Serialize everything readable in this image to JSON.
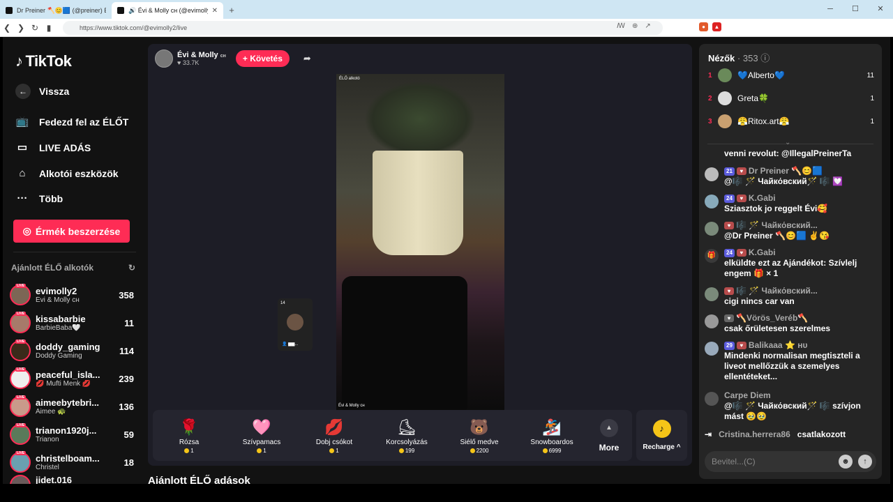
{
  "browser": {
    "tabs": [
      {
        "title": "Dr Preiner 🪓😊🟦 (@preiner) ÉLŐ",
        "active": false
      },
      {
        "title": "🔊 Évi & Molly ᴄʜ (@evimolly2) ÉLŐ",
        "active": true
      }
    ],
    "url": "https://www.tiktok.com/@evimolly2/live",
    "new_tab": "+",
    "min": "─",
    "max": "☐",
    "close": "✕"
  },
  "sidebar": {
    "logo": "TikTok",
    "back": "Vissza",
    "nav": [
      {
        "label": "Fedezd fel az ÉLŐT",
        "icon": "tv-icon"
      },
      {
        "label": "LIVE ADÁS",
        "icon": "video-icon"
      },
      {
        "label": "Alkotói eszközök",
        "icon": "home-play-icon"
      },
      {
        "label": "Több",
        "icon": "more-icon"
      }
    ],
    "coin_button": "Érmék beszerzése",
    "suggest_title": "Ajánlott ÉLŐ alkotók",
    "creators": [
      {
        "name": "evimolly2",
        "sub": "Évi & Molly ᴄʜ",
        "count": "358"
      },
      {
        "name": "kissabarbie",
        "sub": "BarbieBaba🤍",
        "count": "11"
      },
      {
        "name": "doddy_gaming",
        "sub": "Doddy Gaming",
        "count": "114"
      },
      {
        "name": "peaceful_isla...",
        "sub": "💋 Mufti Menk 💋",
        "count": "239"
      },
      {
        "name": "aimeebytebri...",
        "sub": "Aimee 🐢",
        "count": "136"
      },
      {
        "name": "trianon1920j...",
        "sub": "Trianon",
        "count": "59"
      },
      {
        "name": "christelboam...",
        "sub": "Christel",
        "count": "18"
      },
      {
        "name": "jidet.016",
        "sub": "",
        "count": ""
      }
    ]
  },
  "host": {
    "name": "Évi & Molly",
    "badge": "ᴄʜ",
    "likes": "♥ 33.7K",
    "follow": "+ Követés"
  },
  "video": {
    "top_label": "ÉLŐ alkotó",
    "bottom_label": "Évi & Molly ᴄʜ",
    "guest_count": "14",
    "guest_label": "👤 ▆▆..."
  },
  "gifts": [
    {
      "name": "Rózsa",
      "price": "1",
      "icon": "🌹"
    },
    {
      "name": "Szívpamacs",
      "price": "1",
      "icon": "🩷"
    },
    {
      "name": "Dobj csókot",
      "price": "1",
      "icon": "💋"
    },
    {
      "name": "Korcsolyázás",
      "price": "199",
      "icon": "⛸"
    },
    {
      "name": "Siélő medve",
      "price": "2200",
      "icon": "🐻"
    },
    {
      "name": "Snowboardos",
      "price": "6999",
      "icon": "🏂"
    }
  ],
  "more_label": "More",
  "recharge_label": "Recharge ^",
  "below_title": "Ajánlott ÉLŐ adások",
  "chat": {
    "viewers_title": "Nézők",
    "viewers_count": "· 353",
    "top_viewers": [
      {
        "rank": "1",
        "name": "💙Alberto💙",
        "score": "11"
      },
      {
        "rank": "2",
        "name": "Greta🍀",
        "score": "1"
      },
      {
        "rank": "3",
        "name": "😤Ritox.art😤",
        "score": "1"
      }
    ],
    "messages": [
      {
        "user": "",
        "level": "",
        "text": "venni revolut: @IllegalPreinerTa"
      },
      {
        "user": "Dr Preiner 🪓😊🟦",
        "level": "21",
        "text": "@🎼 🪄 Чайкόвский🪄 🎼 💟"
      },
      {
        "user": "K.Gabi",
        "level": "24",
        "text": "Sziasztok jo reggelt Évi🥰"
      },
      {
        "user": "🎼 🪄 Чайкόвский...",
        "level": "",
        "text": "@Dr Preiner 🪓😊🟦 ✌️😘"
      },
      {
        "user": "K.Gabi",
        "level": "24",
        "text": "elküldte ezt az Ajándékot: Szívlelj engem 🎁 × 1"
      },
      {
        "user": "🎼 🪄 Чайкόвский...",
        "level": "",
        "text": "cigi nincs car van"
      },
      {
        "user": "🪓Vörös_Veréb🪓",
        "level": "",
        "text": "csak őrületesen szerelmes"
      },
      {
        "user": "Balikaaa ⭐ ʜᴜ",
        "level": "29",
        "text": "Mindenki normalisan megtiszteli a liveot mellőzzük a szemelyes ellentéteket..."
      },
      {
        "user": "Carpe Diem",
        "level": "",
        "text": "@🎼 🪄 Чайкόвский🪄 🎼 szívjon mást 🥹🥹"
      }
    ],
    "join_name": "Cristina.herrera86",
    "join_text": "csatlakozott",
    "input_placeholder": "Bevitel...(C)"
  }
}
